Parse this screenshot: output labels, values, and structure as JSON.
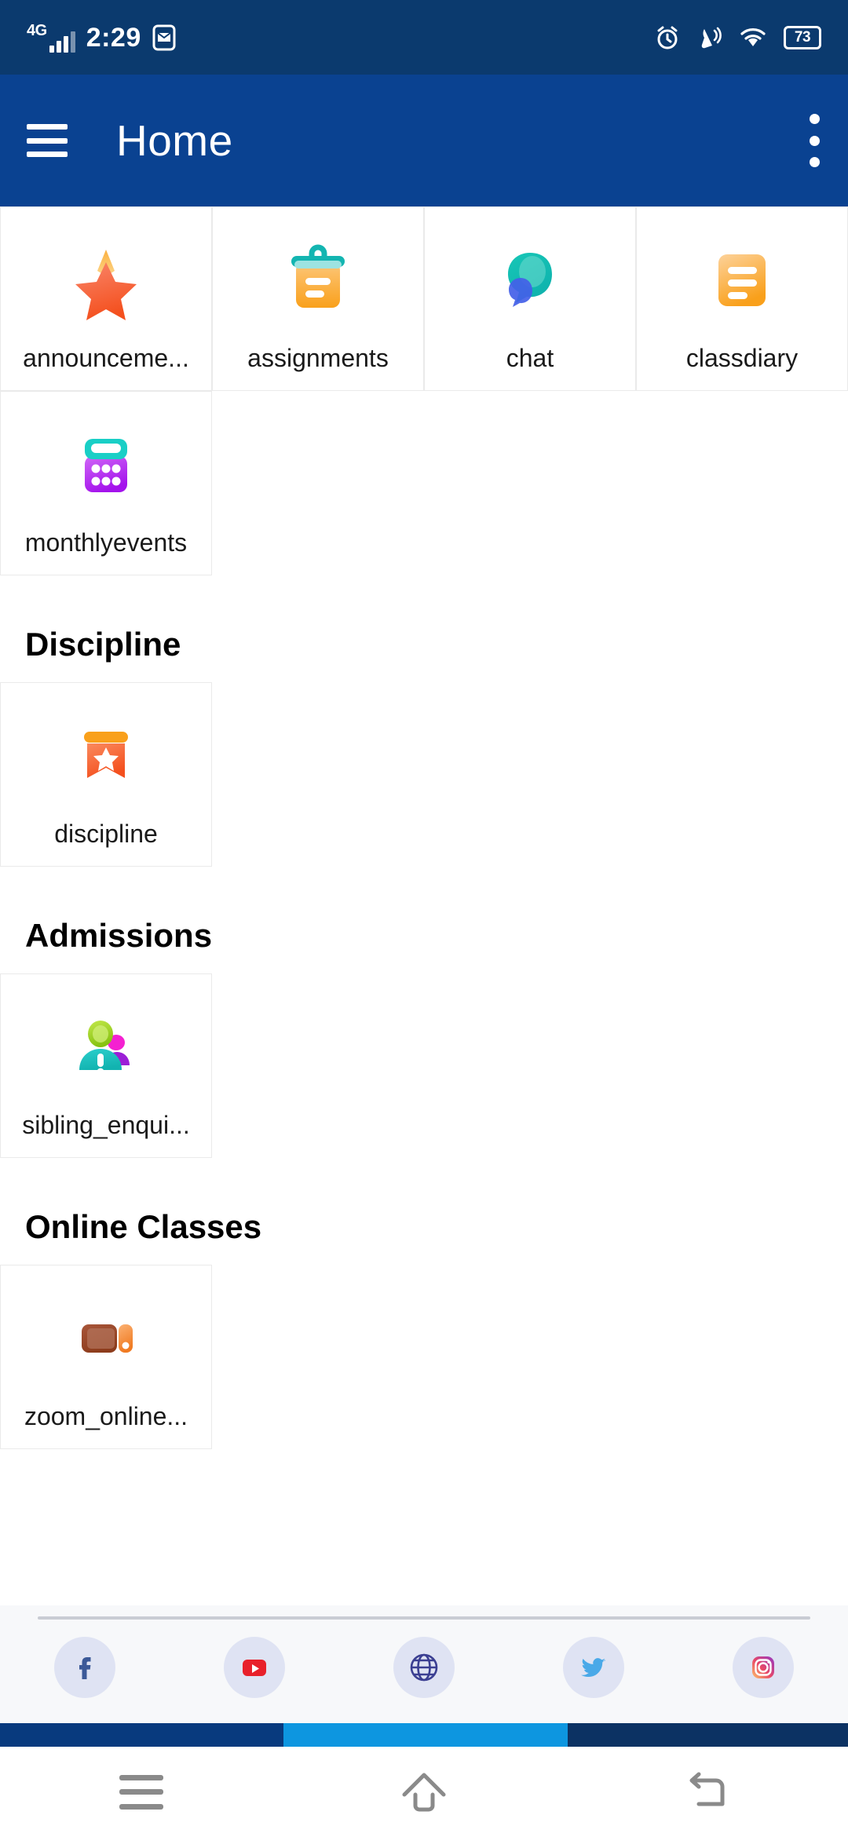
{
  "status_bar": {
    "network_type": "4G",
    "time": "2:29",
    "mail_icon": "mail-icon",
    "alarm_icon": "alarm-icon",
    "vibrate_icon": "vibrate-call-icon",
    "wifi_icon": "wifi-icon",
    "battery_level": "73"
  },
  "app_bar": {
    "menu_icon": "hamburger-menu-icon",
    "title": "Home",
    "overflow_icon": "overflow-menu-icon"
  },
  "sections": [
    {
      "heading": "",
      "tiles": [
        {
          "label": "announceme...",
          "icon": "star-icon"
        },
        {
          "label": "assignments",
          "icon": "clipboard-icon"
        },
        {
          "label": "chat",
          "icon": "chat-bubble-icon"
        },
        {
          "label": "classdiary",
          "icon": "document-icon"
        },
        {
          "label": "monthlyevents",
          "icon": "calendar-icon"
        }
      ]
    },
    {
      "heading": "Discipline",
      "tiles": [
        {
          "label": "discipline",
          "icon": "ribbon-star-icon"
        }
      ]
    },
    {
      "heading": "Admissions",
      "tiles": [
        {
          "label": "sibling_enqui...",
          "icon": "people-alert-icon"
        }
      ]
    },
    {
      "heading": "Online Classes",
      "tiles": [
        {
          "label": "zoom_online...",
          "icon": "zoom-video-icon"
        }
      ]
    }
  ],
  "social": [
    {
      "name": "facebook-icon"
    },
    {
      "name": "youtube-icon"
    },
    {
      "name": "website-globe-icon"
    },
    {
      "name": "twitter-icon"
    },
    {
      "name": "instagram-icon"
    }
  ],
  "color_strip": {
    "left": "#083a7e",
    "middle": "#0d96e0",
    "right": "#0c3263"
  },
  "nav_bar": {
    "recents_icon": "recents-icon",
    "home_icon": "home-icon",
    "back_icon": "back-icon"
  },
  "colors": {
    "status_bar_bg": "#0b3a6e",
    "app_bar_bg": "#0a4291",
    "tile_border": "#eaeaea",
    "social_bg": "#f7f8fa",
    "social_circle": "#dfe3f3"
  }
}
